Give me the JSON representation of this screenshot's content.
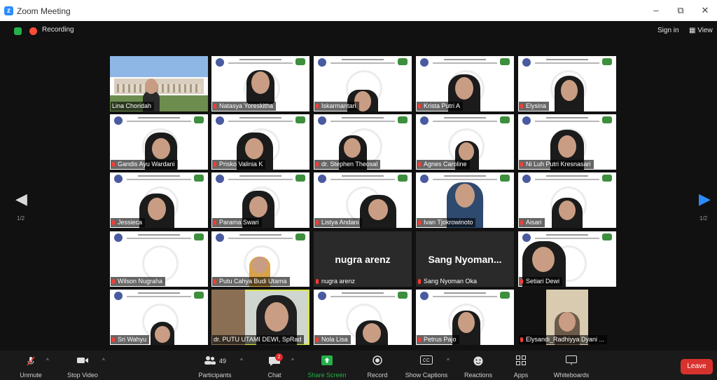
{
  "window": {
    "title": "Zoom Meeting",
    "minimize": "–",
    "restore": "⧉",
    "close": "✕"
  },
  "topbar": {
    "recording": "Recording",
    "sign_in": "Sign in",
    "view": "▦ View"
  },
  "nav": {
    "prev_icon": "◀",
    "next_icon": "▶",
    "page_left": "1/2",
    "page_right": "1/2"
  },
  "participants": [
    {
      "name": "Lina Choridah"
    },
    {
      "name": "Natasya Yoreskitha"
    },
    {
      "name": "Iskarmantari"
    },
    {
      "name": "Krista Putri A"
    },
    {
      "name": "Elysina"
    },
    {
      "name": "Gandis Ayu Wardani"
    },
    {
      "name": "Prisko Valinia K"
    },
    {
      "name": "dr. Stephen Theosal"
    },
    {
      "name": "Agnes Caroline"
    },
    {
      "name": "Ni Luh Putri Kresnasari"
    },
    {
      "name": "Jessieca"
    },
    {
      "name": "Parama Swari"
    },
    {
      "name": "Listya Andani"
    },
    {
      "name": "Ivan Tjokrowinoto"
    },
    {
      "name": "Aisari"
    },
    {
      "name": "Wilson Nugraha"
    },
    {
      "name": "Putu Cahya Budi Utama"
    },
    {
      "name": "nugra arenz",
      "display": "nugra arenz"
    },
    {
      "name": "Sang Nyoman Oka",
      "display": "Sang  Nyoman..."
    },
    {
      "name": "Setiari Dewi"
    },
    {
      "name": "Sri Wahyu"
    },
    {
      "name": "dr. PUTU UTAMI DEWI, SpRad"
    },
    {
      "name": "Nola Lisa"
    },
    {
      "name": "Petrus Pajo"
    },
    {
      "name": "Elysandi_Radhiyya Dyani ..."
    }
  ],
  "toolbar": {
    "unmute": "Unmute",
    "stop_video": "Stop Video",
    "participants": "Participants",
    "participants_count": "49",
    "chat": "Chat",
    "chat_badge": "2",
    "share_screen": "Share Screen",
    "record": "Record",
    "show_captions": "Show Captions",
    "reactions": "Reactions",
    "apps": "Apps",
    "whiteboards": "Whiteboards",
    "leave": "Leave"
  },
  "colors": {
    "accent": "#2d8cff",
    "share": "#25b04a",
    "leave": "#d8322e",
    "recording": "#ff4d3a",
    "speaker_outline": "#d7e64b"
  }
}
